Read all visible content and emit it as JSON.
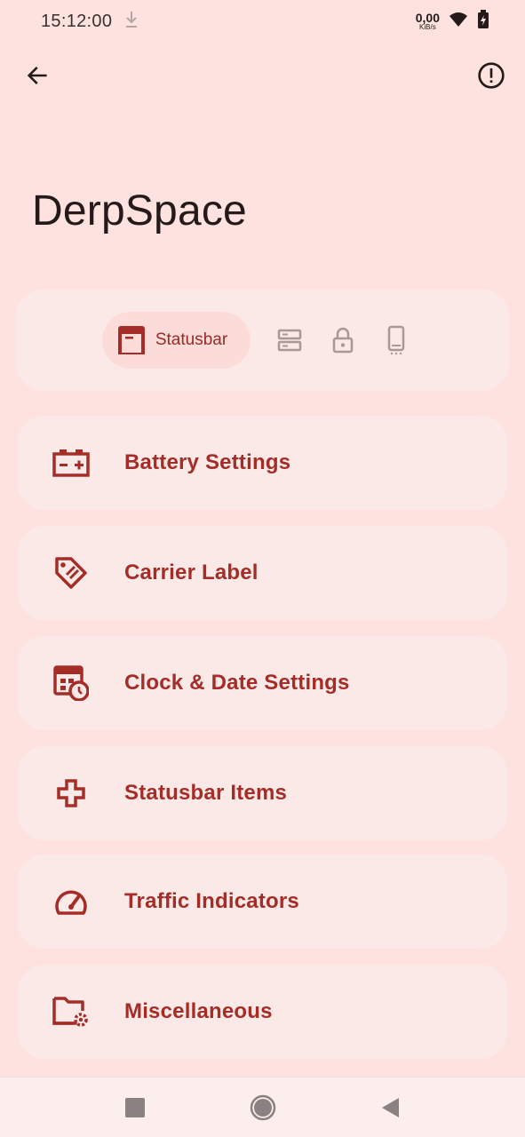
{
  "status_bar": {
    "time": "15:12:00",
    "net_speed_value": "0,00",
    "net_speed_unit": "KiB/s"
  },
  "page": {
    "title": "DerpSpace"
  },
  "tabs": {
    "active_label": "Statusbar",
    "items": [
      "statusbar",
      "quick-settings",
      "lockscreen",
      "device"
    ]
  },
  "menu": {
    "items": [
      {
        "label": "Battery Settings",
        "icon": "battery-plus-icon"
      },
      {
        "label": "Carrier Label",
        "icon": "label-tag-icon"
      },
      {
        "label": "Clock & Date Settings",
        "icon": "calendar-clock-icon"
      },
      {
        "label": "Statusbar Items",
        "icon": "plus-outline-icon"
      },
      {
        "label": "Traffic Indicators",
        "icon": "speedometer-icon"
      },
      {
        "label": "Miscellaneous",
        "icon": "folder-gear-icon"
      }
    ]
  },
  "colors": {
    "background": "#fde2df",
    "card": "#fbe9e7",
    "accent": "#a52d28",
    "inactive_icon": "#a89896"
  }
}
